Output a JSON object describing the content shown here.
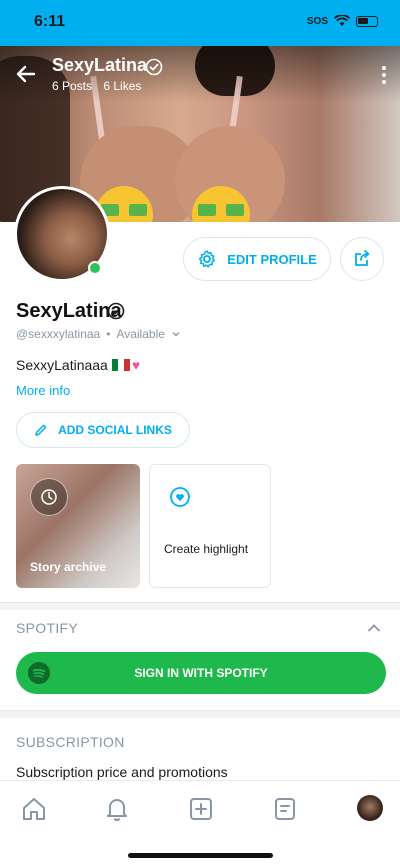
{
  "status_bar": {
    "time": "6:11",
    "carrier": "SOS"
  },
  "header": {
    "name": "SexyLatina",
    "posts": "6 Posts",
    "likes": "6 Likes"
  },
  "profile": {
    "name": "SexyLatina",
    "handle": "@sexxxylatinaa",
    "separator": "•",
    "availability": "Available",
    "bio": "SexxyLatinaaa",
    "more_info": "More info"
  },
  "buttons": {
    "edit_profile": "EDIT PROFILE",
    "add_social_links": "ADD SOCIAL LINKS",
    "sign_in_spotify": "SIGN IN WITH SPOTIFY"
  },
  "highlights": {
    "story_archive": "Story archive",
    "create_highlight": "Create highlight"
  },
  "sections": {
    "spotify": "SPOTIFY",
    "subscription": "SUBSCRIPTION",
    "subscription_item": "Subscription price and promotions"
  },
  "colors": {
    "accent": "#00aff0",
    "spotify_green": "#1fb84c",
    "online": "#2ec05a"
  },
  "icons": [
    "back-arrow-icon",
    "verified-icon",
    "more-vertical-icon",
    "gear-icon",
    "share-icon",
    "pencil-icon",
    "clock-icon",
    "highlight-icon",
    "chevron-up-icon",
    "spotify-icon",
    "home-icon",
    "bell-icon",
    "plus-square-icon",
    "messages-icon"
  ]
}
